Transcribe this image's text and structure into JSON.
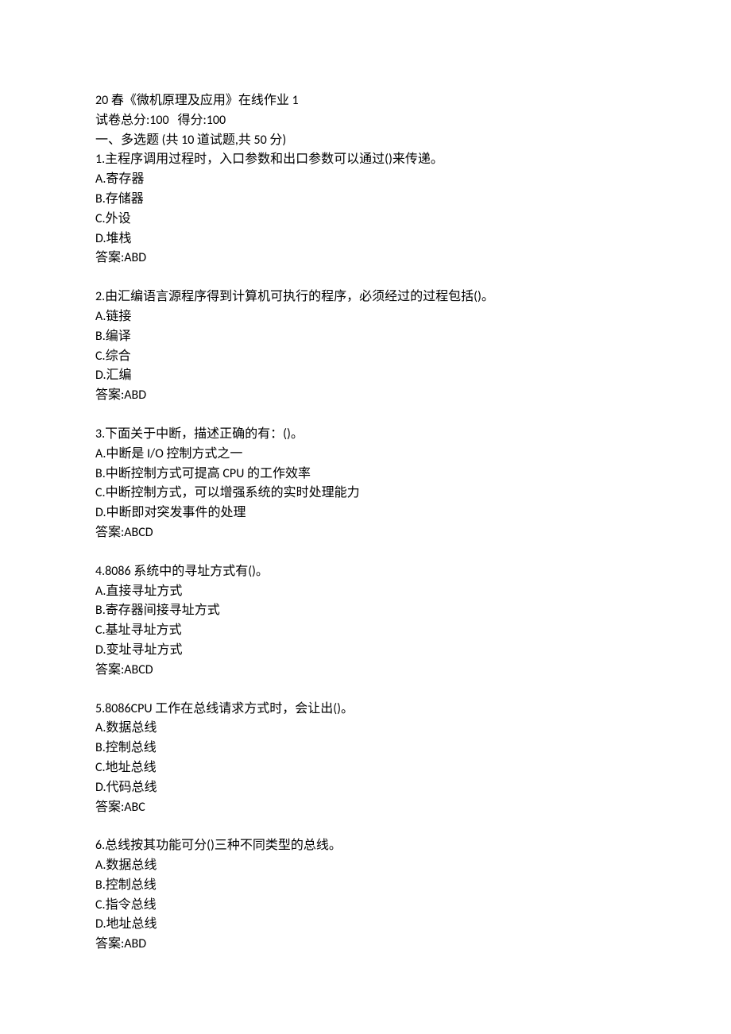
{
  "header": {
    "title": "20 春《微机原理及应用》在线作业 1",
    "scoreline": "试卷总分:100   得分:100",
    "section": "一、多选题 (共 10 道试题,共 50 分)"
  },
  "questions": [
    {
      "stem": "1.主程序调用过程时，入口参数和出口参数可以通过()来传递。",
      "options": [
        "A.寄存器",
        "B.存储器",
        "C.外设",
        "D.堆栈"
      ],
      "answer": "答案:ABD"
    },
    {
      "stem": "2.由汇编语言源程序得到计算机可执行的程序，必须经过的过程包括()。",
      "options": [
        "A.链接",
        "B.编译",
        "C.综合",
        "D.汇编"
      ],
      "answer": "答案:ABD"
    },
    {
      "stem": "3.下面关于中断，描述正确的有：()。",
      "options": [
        "A.中断是 I/O 控制方式之一",
        "B.中断控制方式可提高 CPU 的工作效率",
        "C.中断控制方式，可以增强系统的实时处理能力",
        "D.中断即对突发事件的处理"
      ],
      "answer": "答案:ABCD"
    },
    {
      "stem": "4.8086 系统中的寻址方式有()。",
      "options": [
        "A.直接寻址方式",
        "B.寄存器间接寻址方式",
        "C.基址寻址方式",
        "D.变址寻址方式"
      ],
      "answer": "答案:ABCD"
    },
    {
      "stem": "5.8086CPU 工作在总线请求方式时，会让出()。",
      "options": [
        "A.数据总线",
        "B.控制总线",
        "C.地址总线",
        "D.代码总线"
      ],
      "answer": "答案:ABC"
    },
    {
      "stem": "6.总线按其功能可分()三种不同类型的总线。",
      "options": [
        "A.数据总线",
        "B.控制总线",
        "C.指令总线",
        "D.地址总线"
      ],
      "answer": "答案:ABD"
    }
  ]
}
